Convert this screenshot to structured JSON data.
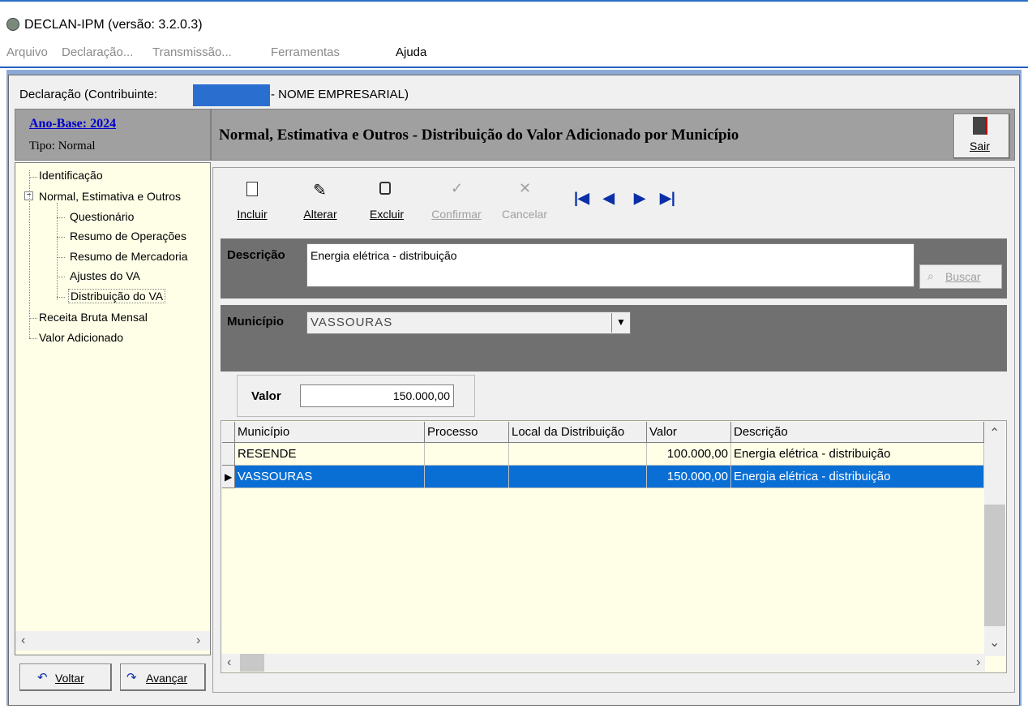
{
  "window": {
    "title": "DECLAN-IPM (versão: 3.2.0.3)"
  },
  "menu": {
    "items": [
      "Arquivo",
      "Declaração...",
      "Transmissão...",
      "Ferramentas",
      "Ajuda"
    ]
  },
  "header": {
    "declaracao_prefix": "Declaração (Contribuinte:",
    "declaracao_suffix": "- NOME EMPRESARIAL)"
  },
  "left_panel": {
    "ano_base": "Ano-Base: 2024",
    "tipo": "Tipo: Normal",
    "tree": [
      {
        "label": "Identificação",
        "level": 0
      },
      {
        "label": "Normal, Estimativa e Outros",
        "level": 0,
        "expanded": true
      },
      {
        "label": "Questionário",
        "level": 1
      },
      {
        "label": "Resumo de Operações",
        "level": 1
      },
      {
        "label": "Resumo de Mercadoria",
        "level": 1
      },
      {
        "label": "Ajustes do VA",
        "level": 1
      },
      {
        "label": "Distribuição do VA",
        "level": 1,
        "selected": true
      },
      {
        "label": "Receita Bruta Mensal",
        "level": 0
      },
      {
        "label": "Valor Adicionado",
        "level": 0
      }
    ],
    "voltar_label": "Voltar",
    "avancar_label": "Avançar"
  },
  "page": {
    "title": "Normal, Estimativa e Outros - Distribuição do Valor Adicionado por Município",
    "sair_label": "Sair"
  },
  "toolbar": {
    "incluir": "Incluir",
    "alterar": "Alterar",
    "excluir": "Excluir",
    "confirmar": "Confirmar",
    "cancelar": "Cancelar"
  },
  "form": {
    "descricao_label": "Descrição",
    "descricao_value": "Energia elétrica - distribuição",
    "buscar_label": "Buscar",
    "municipio_label": "Município",
    "municipio_value": "VASSOURAS",
    "valor_label": "Valor",
    "valor_value": "150.000,00"
  },
  "grid": {
    "columns": [
      "Município",
      "Processo",
      "Local da Distribuição",
      "Valor",
      "Descrição"
    ],
    "rows": [
      {
        "municipio": "RESENDE",
        "processo": "",
        "local": "",
        "valor": "100.000,00",
        "descricao": "Energia elétrica - distribuição",
        "selected": false
      },
      {
        "municipio": "VASSOURAS",
        "processo": "",
        "local": "",
        "valor": "150.000,00",
        "descricao": "Energia elétrica - distribuição",
        "selected": true
      }
    ]
  },
  "colors": {
    "selection": "#0a6fd4",
    "tree_bg": "#ffffe8",
    "header_gray": "#a0a0a0",
    "band_gray": "#707070"
  }
}
